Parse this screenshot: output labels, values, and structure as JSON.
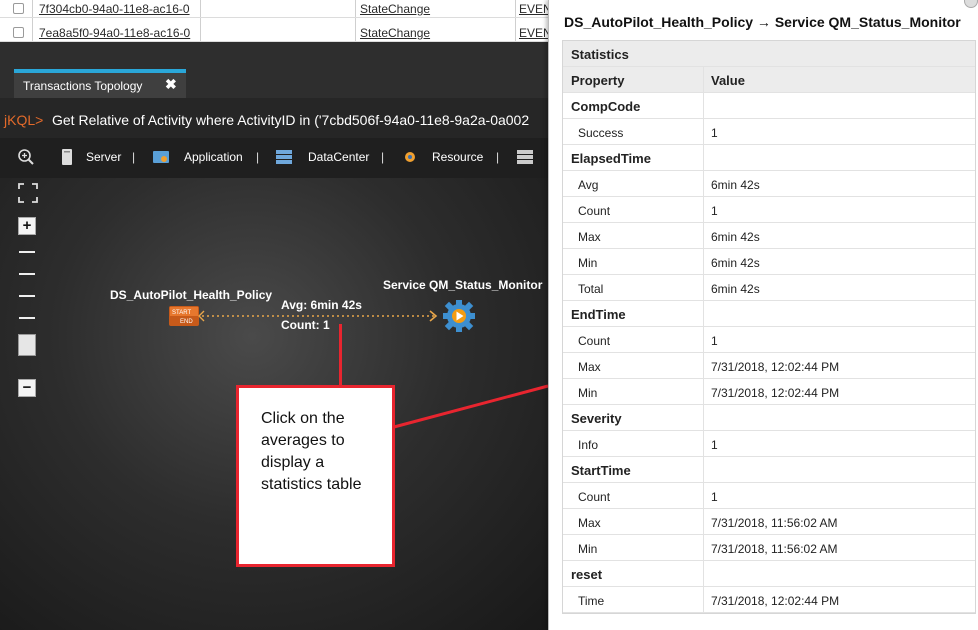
{
  "events": {
    "rows": [
      {
        "id": "7f304cb0-94a0-11e8-ac16-0",
        "type": "StateChange",
        "kind": "EVEN"
      },
      {
        "id": "7ea8a5f0-94a0-11e8-ac16-0",
        "type": "StateChange",
        "kind": "EVEN"
      }
    ]
  },
  "topology": {
    "tab_label": "Transactions Topology",
    "tab_close": "✖",
    "query_prompt": "jKQL>",
    "query_text": "Get Relative of Activity where ActivityID in ('7cbd506f-94a0-11e8-9a2a-0a002",
    "toolbar": {
      "server": "Server",
      "application": "Application",
      "datacenter": "DataCenter",
      "resource": "Resource",
      "sep": "|"
    },
    "zoom_in": "+",
    "zoom_out": "−",
    "nodes": {
      "source_label": "DS_AutoPilot_Health_Policy",
      "source_start": "START",
      "source_end": "END",
      "target_label": "Service QM_Status_Monitor"
    },
    "edge": {
      "avg": "Avg: 6min  42s",
      "count": "Count: 1"
    }
  },
  "callout": {
    "text": "Click on the averages to display a statistics table"
  },
  "stats_panel": {
    "title": "DS_AutoPilot_Health_Policy → Service QM_Status_Monitor",
    "caption": "Statistics",
    "header": {
      "property": "Property",
      "value": "Value"
    },
    "groups": [
      {
        "name": "CompCode",
        "rows": [
          {
            "k": "Success",
            "v": "1"
          }
        ]
      },
      {
        "name": "ElapsedTime",
        "rows": [
          {
            "k": "Avg",
            "v": "6min 42s"
          },
          {
            "k": "Count",
            "v": "1"
          },
          {
            "k": "Max",
            "v": "6min 42s"
          },
          {
            "k": "Min",
            "v": "6min 42s"
          },
          {
            "k": "Total",
            "v": "6min 42s"
          }
        ]
      },
      {
        "name": "EndTime",
        "rows": [
          {
            "k": "Count",
            "v": "1"
          },
          {
            "k": "Max",
            "v": "7/31/2018, 12:02:44 PM"
          },
          {
            "k": "Min",
            "v": "7/31/2018, 12:02:44 PM"
          }
        ]
      },
      {
        "name": "Severity",
        "rows": [
          {
            "k": "Info",
            "v": "1"
          }
        ]
      },
      {
        "name": "StartTime",
        "rows": [
          {
            "k": "Count",
            "v": "1"
          },
          {
            "k": "Max",
            "v": "7/31/2018, 11:56:02 AM"
          },
          {
            "k": "Min",
            "v": "7/31/2018, 11:56:02 AM"
          }
        ]
      },
      {
        "name": "reset",
        "rows": [
          {
            "k": "Time",
            "v": "7/31/2018, 12:02:44 PM"
          }
        ]
      }
    ]
  },
  "colors": {
    "accent_tab": "#2aa7d9",
    "callout_red": "#e8252f",
    "prompt_orange": "#e36a2a",
    "edge_dots": "#e8a64a"
  }
}
